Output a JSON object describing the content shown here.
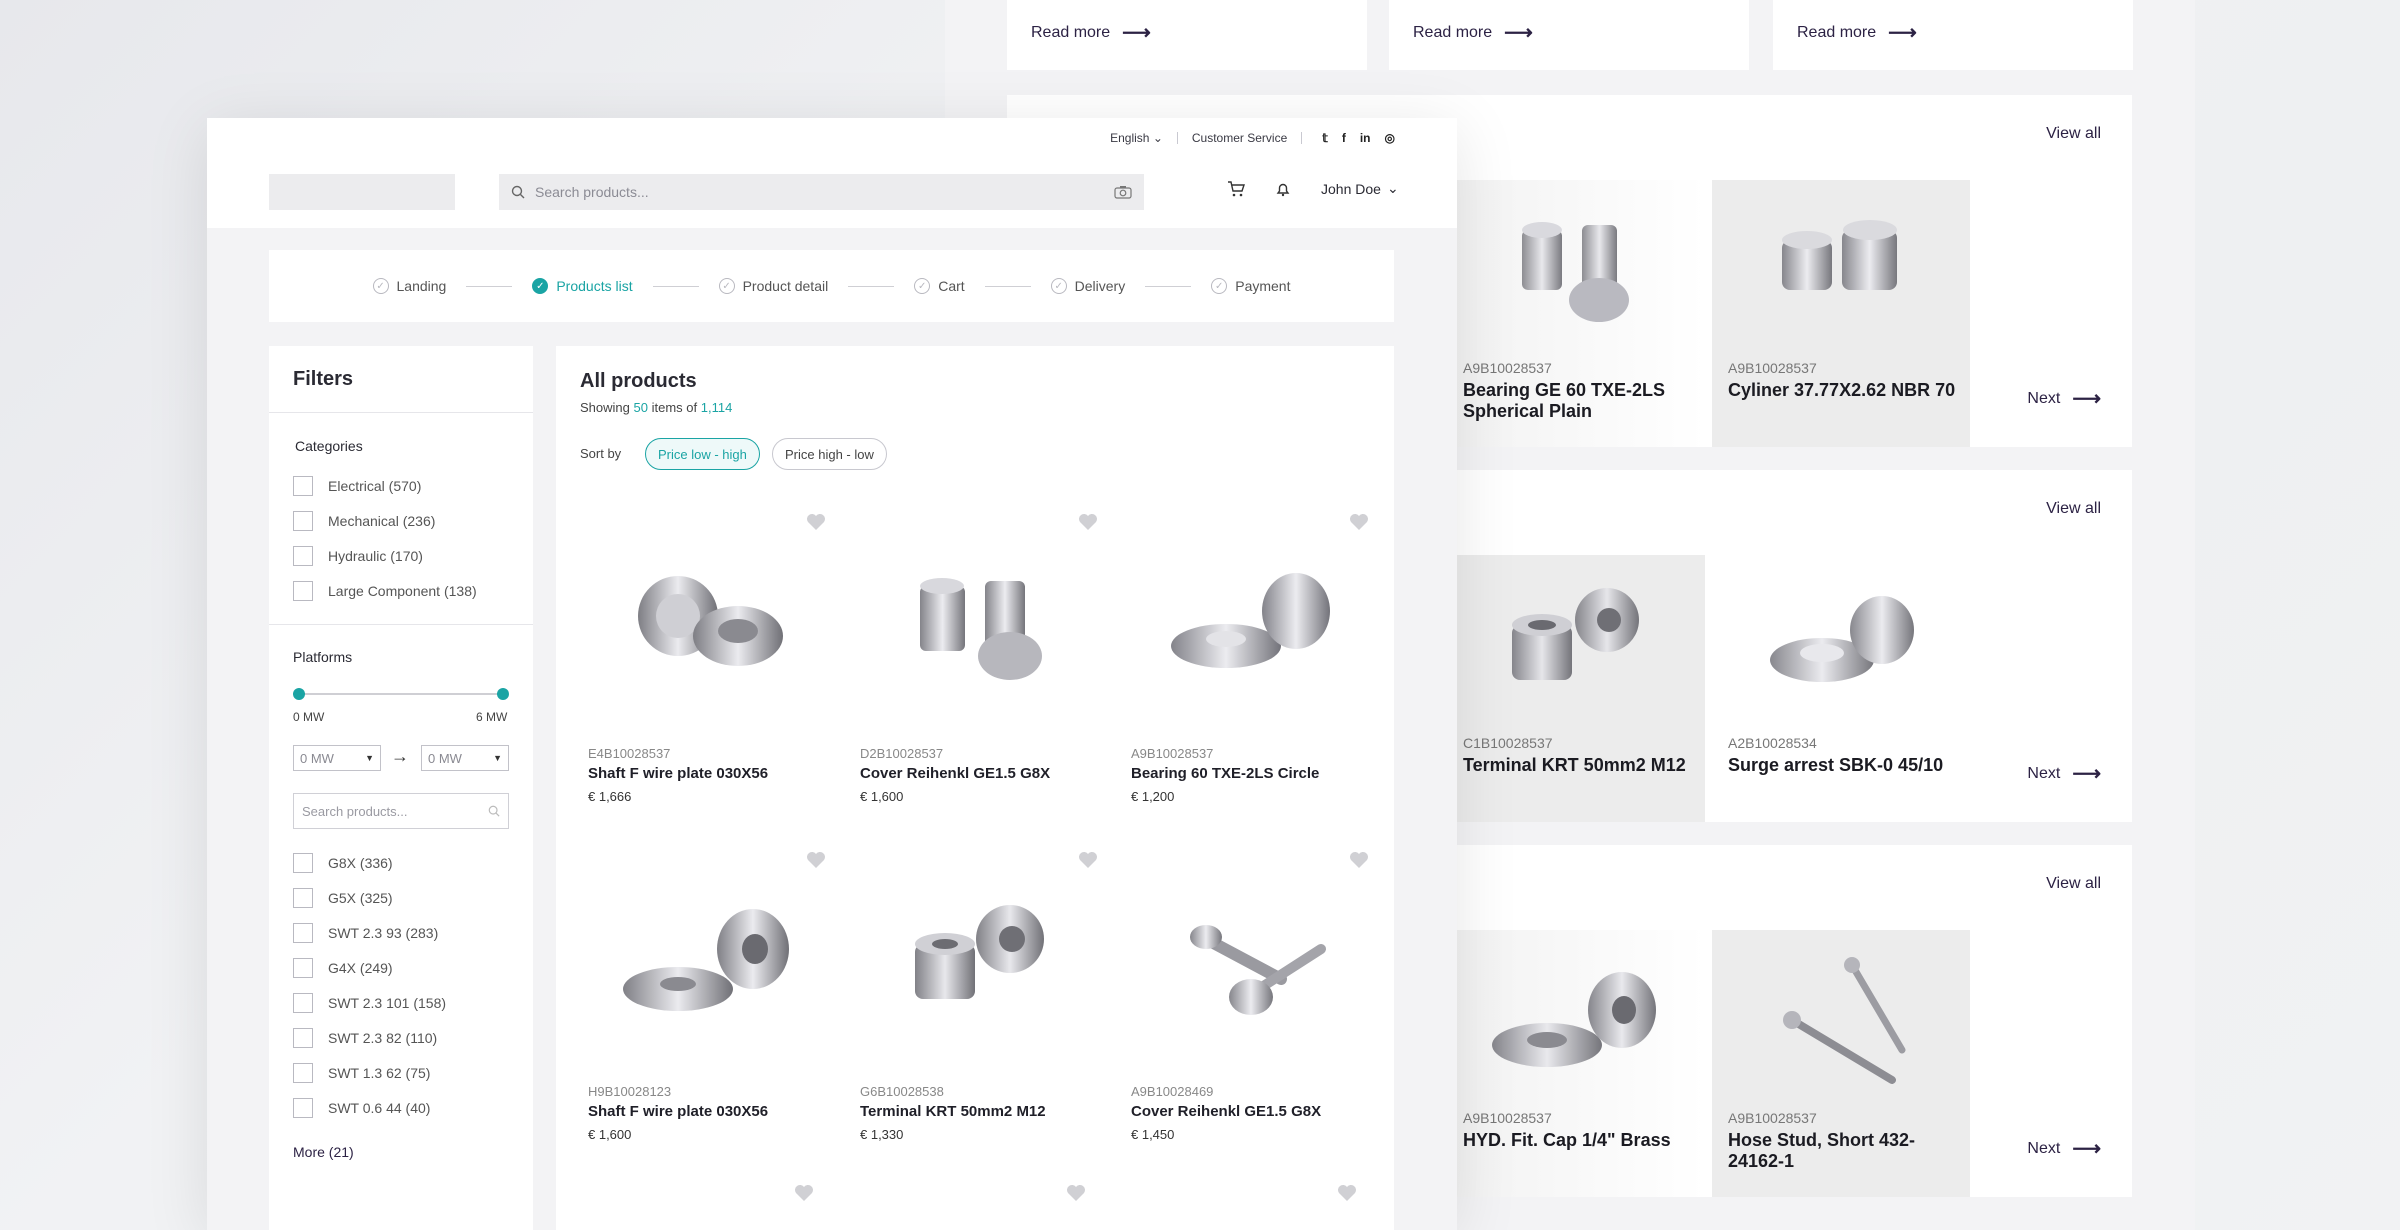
{
  "back": {
    "read_more": [
      "Read more",
      "Read more",
      "Read more"
    ],
    "shelves": [
      {
        "view_all": "View all",
        "next": "Next",
        "items": [
          {
            "sku": "A9B10028537",
            "name": "Bearing GE 60 TXE-2LS Spherical Plain"
          },
          {
            "sku": "A9B10028537",
            "name": "Cyliner 37.77X2.62 NBR 70"
          }
        ]
      },
      {
        "view_all": "View all",
        "next": "Next",
        "items": [
          {
            "sku": "C1B10028537",
            "name": "Terminal KRT 50mm2 M12"
          },
          {
            "sku": "A2B10028534",
            "name": "Surge arrest SBK-0 45/10"
          }
        ]
      },
      {
        "view_all": "View all",
        "next": "Next",
        "items": [
          {
            "sku": "A9B10028537",
            "name": "HYD. Fit. Cap 1/4\" Brass"
          },
          {
            "sku": "A9B10028537",
            "name": "Hose Stud, Short 432-24162-1"
          }
        ]
      }
    ]
  },
  "header": {
    "language": "English",
    "customer_service": "Customer Service",
    "search_placeholder": "Search products...",
    "user_name": "John Doe",
    "social_icons": [
      "twitter-icon",
      "facebook-icon",
      "linkedin-icon",
      "instagram-icon"
    ]
  },
  "stepper": {
    "steps": [
      {
        "label": "Landing",
        "state": "done"
      },
      {
        "label": "Products list",
        "state": "active"
      },
      {
        "label": "Product detail",
        "state": "todo"
      },
      {
        "label": "Cart",
        "state": "todo"
      },
      {
        "label": "Delivery",
        "state": "todo"
      },
      {
        "label": "Payment",
        "state": "todo"
      }
    ]
  },
  "filters": {
    "title": "Filters",
    "categories_title": "Categories",
    "categories": [
      "Electrical (570)",
      "Mechanical (236)",
      "Hydraulic (170)",
      "Large Component (138)"
    ],
    "platforms_title": "Platforms",
    "range_min_label": "0 MW",
    "range_max_label": "6 MW",
    "select_from": "0 MW",
    "select_to": "0 MW",
    "search_placeholder": "Search products...",
    "platforms": [
      "G8X (336)",
      "G5X (325)",
      "SWT 2.3 93 (283)",
      "G4X (249)",
      "SWT 2.3 101 (158)",
      "SWT 2.3 82 (110)",
      "SWT 1.3 62 (75)",
      "SWT 0.6 44 (40)"
    ],
    "more": "More (21)"
  },
  "products": {
    "title": "All products",
    "showing_prefix": "Showing",
    "showing_count": "50",
    "showing_middle": "items of",
    "showing_total": "1,114",
    "sort_label": "Sort by",
    "sort_options": [
      "Price low - high",
      "Price high - low"
    ],
    "items": [
      {
        "sku": "E4B10028537",
        "name": "Shaft F wire plate 030X56",
        "price": "€ 1,666"
      },
      {
        "sku": "D2B10028537",
        "name": "Cover Reihenkl GE1.5 G8X",
        "price": "€ 1,600"
      },
      {
        "sku": "A9B10028537",
        "name": "Bearing 60 TXE-2LS Circle",
        "price": "€ 1,200"
      },
      {
        "sku": "H9B10028123",
        "name": "Shaft F wire plate 030X56",
        "price": "€ 1,600"
      },
      {
        "sku": "G6B10028538",
        "name": "Terminal KRT 50mm2 M12",
        "price": "€ 1,330"
      },
      {
        "sku": "A9B10028469",
        "name": "Cover Reihenkl GE1.5 G8X",
        "price": "€ 1,450"
      }
    ]
  },
  "colors": {
    "accent": "#1aa4a4",
    "link": "#2c2244",
    "panel": "#ffffff",
    "backdrop": "#f3f3f5"
  }
}
